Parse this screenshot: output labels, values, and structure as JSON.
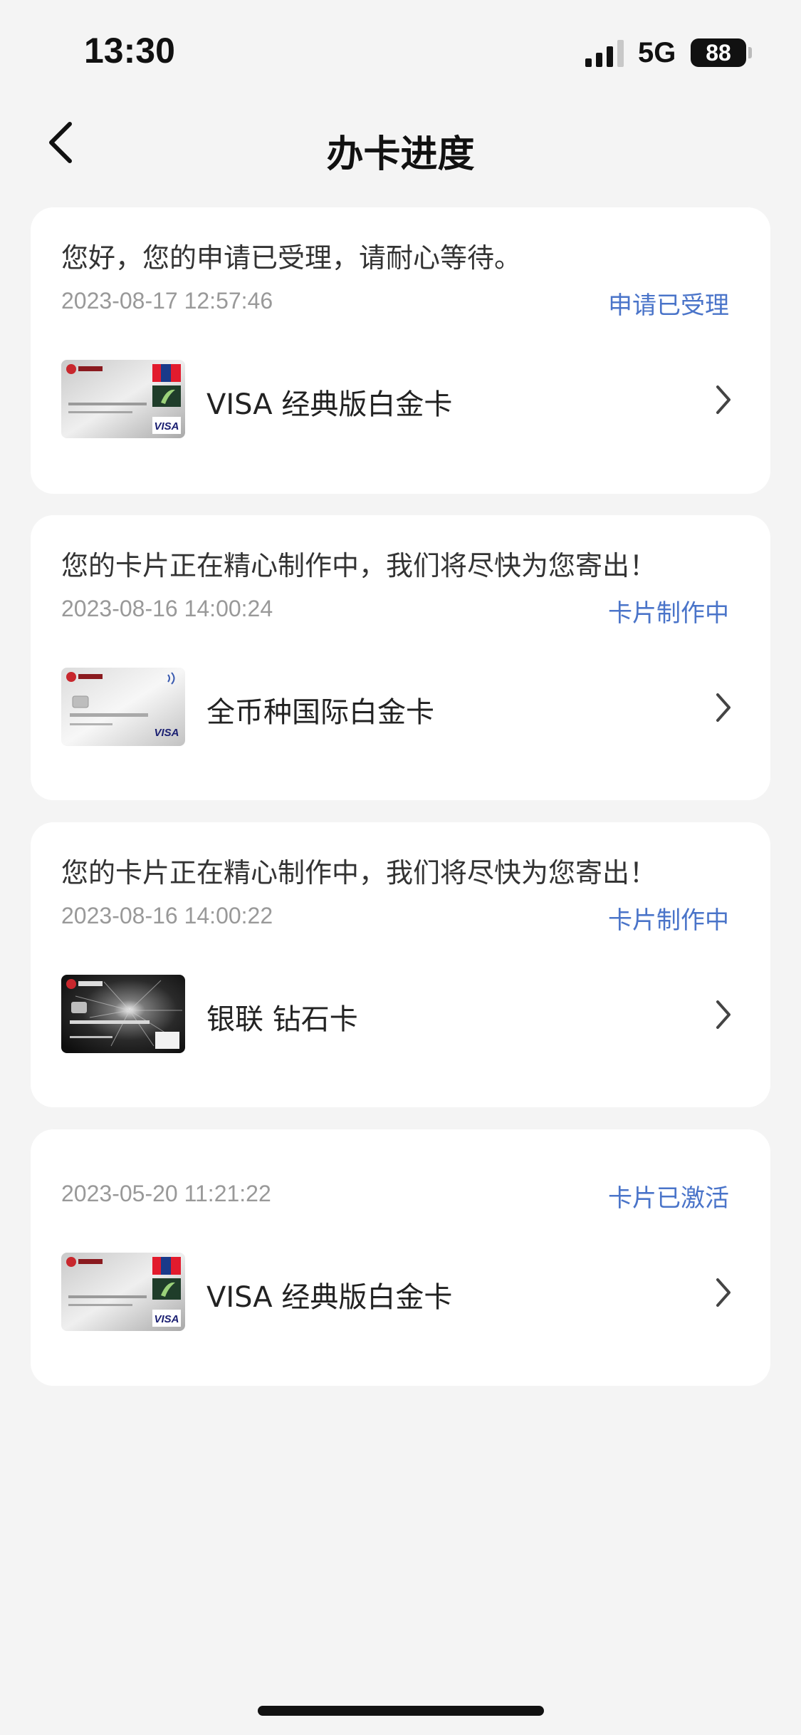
{
  "status_bar": {
    "time": "13:30",
    "network": "5G",
    "battery": "88"
  },
  "header": {
    "title": "办卡进度",
    "back_icon": "chevron-left-icon"
  },
  "applications": [
    {
      "message": "您好，您的申请已受理，请耐心等待。",
      "timestamp": "2023-08-17 12:57:46",
      "status": "申请已受理",
      "card_name": "VISA 经典版白金卡",
      "card_style": "silver-unionpay-visa"
    },
    {
      "message": "您的卡片正在精心制作中，我们将尽快为您寄出！",
      "timestamp": "2023-08-16 14:00:24",
      "status": "卡片制作中",
      "card_name": "全币种国际白金卡",
      "card_style": "white-visa"
    },
    {
      "message": "您的卡片正在精心制作中，我们将尽快为您寄出！",
      "timestamp": "2023-08-16 14:00:22",
      "status": "卡片制作中",
      "card_name": "银联 钻石卡",
      "card_style": "black-diamond"
    },
    {
      "message": "",
      "timestamp": "2023-05-20 11:21:22",
      "status": "卡片已激活",
      "card_name": "VISA 经典版白金卡",
      "card_style": "silver-unionpay-visa"
    }
  ],
  "colors": {
    "background": "#f4f4f4",
    "card": "#ffffff",
    "status_accent": "#4a74c9",
    "timestamp": "#999999"
  }
}
